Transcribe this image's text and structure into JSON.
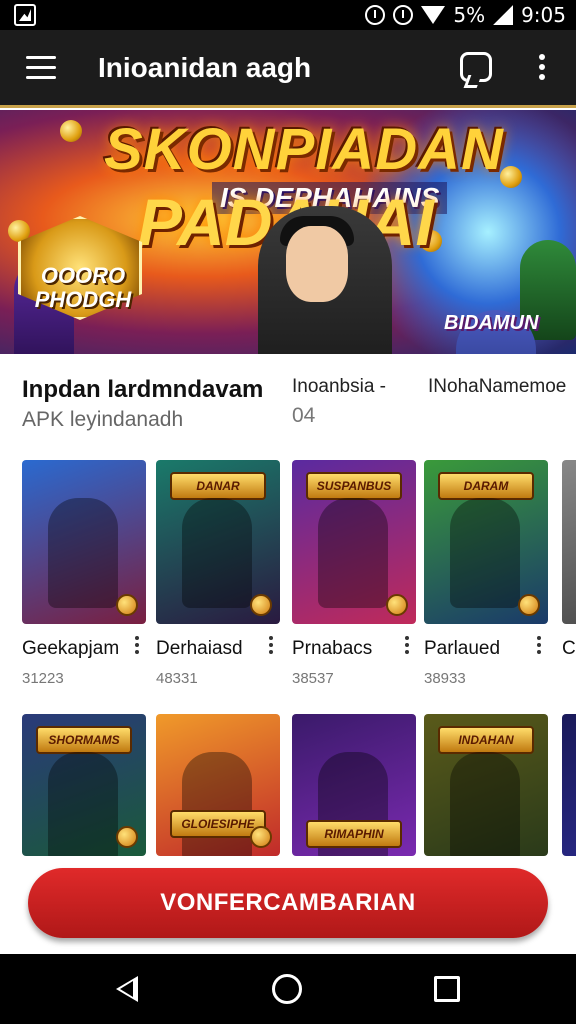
{
  "status_bar": {
    "battery_text": "5%",
    "time": "9:05"
  },
  "app_bar": {
    "title": "Inioanidan aagh"
  },
  "banner": {
    "title": "SKONPIADAN",
    "subtitle": "IS DEPHAHAINS",
    "title_line2": "PADAHAI",
    "badge_text": "OOORO PHODGH",
    "logo_text": "BIDAMUN"
  },
  "app_info": {
    "name": "Inpdan lardmndavam",
    "subtitle": "APK leyindanadh",
    "meta1_label": "Inoanbsia -",
    "meta1_value": "04",
    "meta2_label": "INohaNamemoe"
  },
  "games_row1": [
    {
      "name": "Geekapjam",
      "value": "31223",
      "banner": "",
      "colors": [
        "#2a6ad0",
        "#7a1f40"
      ]
    },
    {
      "name": "Derhaiasd",
      "value": "48331",
      "banner": "DANAR",
      "colors": [
        "#1a7a6a",
        "#2a1a40"
      ]
    },
    {
      "name": "Prnabacs",
      "value": "38537",
      "banner": "SUSPANBUS",
      "colors": [
        "#5a2aa0",
        "#c02a5a"
      ]
    },
    {
      "name": "Parlaued",
      "value": "38933",
      "banner": "DARAM",
      "colors": [
        "#3a9a3a",
        "#1a3a6a"
      ]
    },
    {
      "name": "C",
      "value": "",
      "banner": "",
      "colors": [
        "#888888",
        "#444444"
      ]
    }
  ],
  "games_row2": [
    {
      "banner": "SHORMAMS",
      "colors": [
        "#2a3a7a",
        "#1a5a3a"
      ]
    },
    {
      "banner": "GLOIESIPHE",
      "colors": [
        "#f09a2a",
        "#c02a2a"
      ]
    },
    {
      "banner": "RIMAPHIN",
      "colors": [
        "#3a1a6a",
        "#7a2ab0"
      ]
    },
    {
      "banner": "INDAHAN",
      "colors": [
        "#5a5a1a",
        "#2a3a1a"
      ]
    },
    {
      "banner": "",
      "colors": [
        "#1a1a5a",
        "#2a2a8a"
      ]
    }
  ],
  "cta": {
    "label": "VONFERCAMBARIAN"
  }
}
